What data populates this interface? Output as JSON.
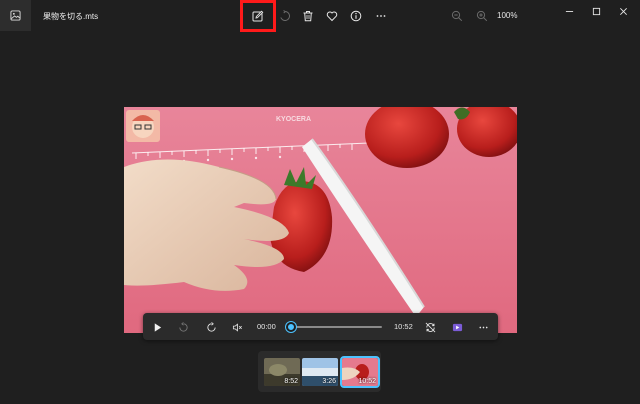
{
  "window": {
    "file_name": "果物を切る.mts",
    "zoom": "100%"
  },
  "toolbar": {
    "buttons": [
      {
        "name": "edit-icon",
        "highlighted": true
      },
      {
        "name": "rotate-icon",
        "enabled": false
      },
      {
        "name": "delete-icon"
      },
      {
        "name": "favorite-icon"
      },
      {
        "name": "info-icon"
      },
      {
        "name": "more-icon"
      }
    ],
    "highlight_color": "#ff1a1a"
  },
  "player": {
    "current_time": "00:00",
    "duration": "10:52",
    "progress": 0,
    "accent": "#4cc2ff",
    "video_brand": "KYOCERA"
  },
  "filmstrip": {
    "items": [
      {
        "duration": "8:52",
        "selected": false
      },
      {
        "duration": "3:26",
        "selected": false
      },
      {
        "duration": "10:52",
        "selected": true
      }
    ]
  }
}
